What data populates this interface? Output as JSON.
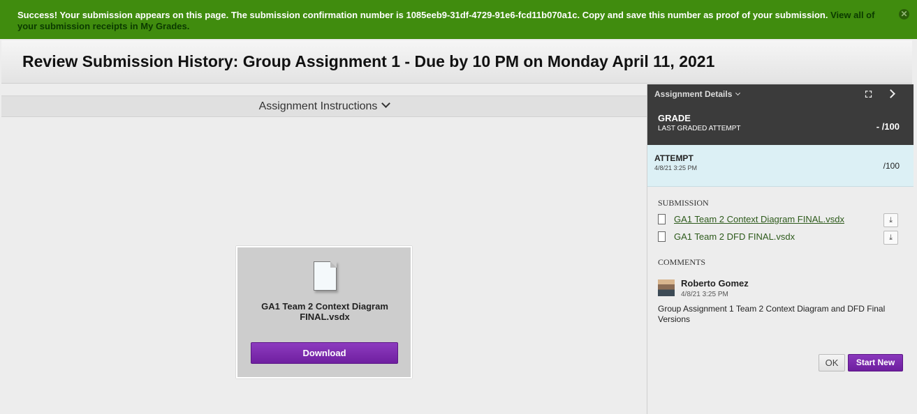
{
  "banner": {
    "message": "Success! Your submission appears on this page. The submission confirmation number is 1085eeb9-31df-4729-91e6-fcd11b070a1c. Copy and save this number as proof of your submission.",
    "link_text": "View all of your submission receipts in My Grades.",
    "close_icon": "close-icon",
    "close_glyph": "✕"
  },
  "header": {
    "title": "Review Submission History: Group Assignment 1 - Due by 10 PM on Monday April 11, 2021"
  },
  "instructions": {
    "label": "Assignment Instructions"
  },
  "file_card": {
    "file_name": "GA1 Team 2 Context Diagram FINAL.vsdx",
    "download_label": "Download"
  },
  "details": {
    "title": "Assignment Details",
    "expand_glyph": "⛶",
    "grade": {
      "label": "GRADE",
      "sublabel": "LAST GRADED ATTEMPT",
      "value": "- /100"
    },
    "attempt": {
      "label": "ATTEMPT",
      "date": "4/8/21 3:25 PM",
      "value": "/100"
    },
    "submission": {
      "heading": "SUBMISSION",
      "files": [
        {
          "name": "GA1 Team 2 Context Diagram FINAL.vsdx",
          "download_glyph": "⤓"
        },
        {
          "name": "GA1 Team 2 DFD FINAL.vsdx",
          "download_glyph": "⤓"
        }
      ]
    },
    "comments": {
      "heading": "COMMENTS",
      "author": "Roberto Gomez",
      "date": "4/8/21 3:25 PM",
      "text": "Group Assignment 1 Team 2 Context Diagram and DFD Final Versions"
    },
    "buttons": {
      "ok": "OK",
      "start_new": "Start New"
    }
  }
}
